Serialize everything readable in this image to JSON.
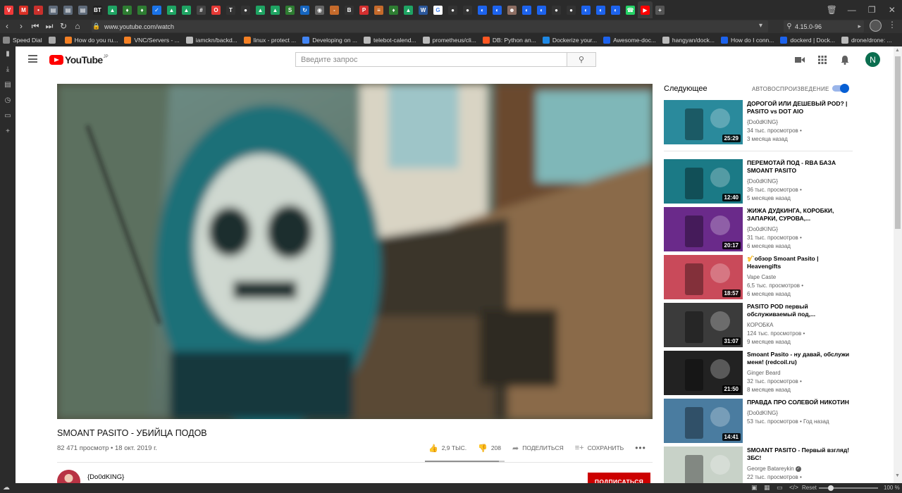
{
  "browser": {
    "url": "www.youtube.com/watch",
    "search_value": "4.15.0-96",
    "tabs": [
      {
        "name": "vivaldi",
        "color": "#ef3939",
        "glyph": "V"
      },
      {
        "name": "mail",
        "color": "#d93025",
        "glyph": "M"
      },
      {
        "name": "chat",
        "color": "#c9302c",
        "glyph": "•"
      },
      {
        "name": "doc",
        "color": "#5f6b7a",
        "glyph": "▤"
      },
      {
        "name": "doc",
        "color": "#5f6b7a",
        "glyph": "▤"
      },
      {
        "name": "doc",
        "color": "#5f6b7a",
        "glyph": "▤"
      },
      {
        "name": "bt",
        "color": "#222",
        "glyph": "BT"
      },
      {
        "name": "drive",
        "color": "#1fa463",
        "glyph": "▲"
      },
      {
        "name": "leaf",
        "color": "#2e7d32",
        "glyph": "♦"
      },
      {
        "name": "leaf",
        "color": "#2e7d32",
        "glyph": "♦"
      },
      {
        "name": "check",
        "color": "#1a73e8",
        "glyph": "✓"
      },
      {
        "name": "drive",
        "color": "#1fa463",
        "glyph": "▲"
      },
      {
        "name": "drive",
        "color": "#1fa463",
        "glyph": "▲"
      },
      {
        "name": "grid",
        "color": "#444",
        "glyph": "#"
      },
      {
        "name": "opera",
        "color": "#e53935",
        "glyph": "O"
      },
      {
        "name": "t",
        "color": "#333",
        "glyph": "T"
      },
      {
        "name": "github",
        "color": "#333",
        "glyph": "●"
      },
      {
        "name": "drive",
        "color": "#1fa463",
        "glyph": "▲"
      },
      {
        "name": "drive",
        "color": "#1fa463",
        "glyph": "▲"
      },
      {
        "name": "s",
        "color": "#2e7d32",
        "glyph": "S"
      },
      {
        "name": "refresh",
        "color": "#1565c0",
        "glyph": "↻"
      },
      {
        "name": "globe",
        "color": "#666",
        "glyph": "◉"
      },
      {
        "name": "dash",
        "color": "#c56a2b",
        "glyph": "-"
      },
      {
        "name": "b",
        "color": "#333",
        "glyph": "B"
      },
      {
        "name": "p",
        "color": "#d32f2f",
        "glyph": "P"
      },
      {
        "name": "bars",
        "color": "#c56a2b",
        "glyph": "≡"
      },
      {
        "name": "leaf",
        "color": "#2e7d32",
        "glyph": "♦"
      },
      {
        "name": "drive",
        "color": "#1fa463",
        "glyph": "▲"
      },
      {
        "name": "word",
        "color": "#2b579a",
        "glyph": "W"
      },
      {
        "name": "google",
        "color": "#fff",
        "glyph": "G"
      },
      {
        "name": "github",
        "color": "#333",
        "glyph": "●"
      },
      {
        "name": "github",
        "color": "#333",
        "glyph": "●"
      },
      {
        "name": "docker",
        "color": "#1d63ed",
        "glyph": "◐"
      },
      {
        "name": "docker",
        "color": "#1d63ed",
        "glyph": "◐"
      },
      {
        "name": "person",
        "color": "#8d6e63",
        "glyph": "☻"
      },
      {
        "name": "docker",
        "color": "#1d63ed",
        "glyph": "◐"
      },
      {
        "name": "docker",
        "color": "#1d63ed",
        "glyph": "◐"
      },
      {
        "name": "github",
        "color": "#333",
        "glyph": "●"
      },
      {
        "name": "github",
        "color": "#333",
        "glyph": "●"
      },
      {
        "name": "docker",
        "color": "#1d63ed",
        "glyph": "◐"
      },
      {
        "name": "docker",
        "color": "#1d63ed",
        "glyph": "◐"
      },
      {
        "name": "docker",
        "color": "#1d63ed",
        "glyph": "◐"
      },
      {
        "name": "whatsapp",
        "color": "#25d366",
        "glyph": "☎"
      },
      {
        "name": "youtube",
        "color": "#ff0000",
        "glyph": "▶"
      },
      {
        "name": "new-tab",
        "color": "#555",
        "glyph": "+"
      }
    ],
    "bookmarks": [
      {
        "label": "Speed Dial",
        "color": "#888"
      },
      {
        "label": "",
        "color": "#aaa"
      },
      {
        "label": "How do you ru...",
        "color": "#f48024"
      },
      {
        "label": "VNC/Servers - ...",
        "color": "#f48024"
      },
      {
        "label": "iamckn/backd...",
        "color": "#bbb"
      },
      {
        "label": "linux - protect ...",
        "color": "#f48024"
      },
      {
        "label": "Developing on ...",
        "color": "#4285f4"
      },
      {
        "label": "telebot-calend...",
        "color": "#bbb"
      },
      {
        "label": "prometheus/cli...",
        "color": "#bbb"
      },
      {
        "label": "DB: Python an...",
        "color": "#ff5722"
      },
      {
        "label": "Dockerize your...",
        "color": "#1e88e5"
      },
      {
        "label": "Awesome-doc...",
        "color": "#1d63ed"
      },
      {
        "label": "hangyan/dock...",
        "color": "#bbb"
      },
      {
        "label": "How do I conn...",
        "color": "#1d63ed"
      },
      {
        "label": "dockerd | Dock...",
        "color": "#1d63ed"
      },
      {
        "label": "drone/drone: ...",
        "color": "#bbb"
      }
    ],
    "zoom_reset": "Reset",
    "zoom_level": "100 %"
  },
  "youtube": {
    "logo_text": "YouTube",
    "region": "JP",
    "search_placeholder": "Введите запрос",
    "avatar_letter": "N"
  },
  "video": {
    "title": "SMOANT PASITO - УБИЙЦА ПОДОВ",
    "meta": "82 471 просмотр • 18 окт. 2019 г.",
    "likes": "2,9 ТЫС.",
    "dislikes": "208",
    "share_label": "ПОДЕЛИТЬСЯ",
    "save_label": "СОХРАНИТЬ",
    "more_label": "•••",
    "like_ratio": 0.93,
    "channel": "{Do0dKING}",
    "subscribe_label": "ПОДПИСАТЬСЯ"
  },
  "sidebar": {
    "next_label": "Следующее",
    "autoplay_label": "АВТОВОСПРОИЗВЕДЕНИЕ",
    "autoplay_on": true,
    "items": [
      {
        "title": "ДОРОГОЙ ИЛИ ДЕШЕВЫЙ POD? | PASITO vs DOT AIO",
        "channel": "{Do0dKING}",
        "views": "34 тыс. просмотров •",
        "age": "3 месяца назад",
        "duration": "25:29",
        "thumb": "#2a8a9c",
        "verified": false
      },
      {
        "title": "ПЕРЕМОТАЙ ПОД - RBA БАЗА SMOANT PASITO",
        "channel": "{Do0dKING}",
        "views": "36 тыс. просмотров •",
        "age": "5 месяцев назад",
        "duration": "12:40",
        "thumb": "#1b7a86",
        "verified": false
      },
      {
        "title": "ЖИЖА ДУДКИНГА, КОРОБКИ, ЗАПАРКИ, СУРОВА,...",
        "channel": "{Do0dKING}",
        "views": "31 тыс. просмотров •",
        "age": "6 месяцев назад",
        "duration": "20:17",
        "thumb": "#6a2a8a",
        "verified": false
      },
      {
        "title": "🎷обзор Smoant Pasito | Heavengifts",
        "channel": "Vape Caste",
        "views": "6,5 тыс. просмотров •",
        "age": "6 месяцев назад",
        "duration": "18:57",
        "thumb": "#c94a5a",
        "verified": false
      },
      {
        "title": "PASITO POD первый обслуживаемый под,...",
        "channel": "КОРОБКА",
        "views": "124 тыс. просмотров •",
        "age": "9 месяцев назад",
        "duration": "31:07",
        "thumb": "#3b3b3b",
        "verified": false
      },
      {
        "title": "Smoant Pasito - ну давай, обслужи меня! (redcoil.ru)",
        "channel": "Ginger Beard",
        "views": "32 тыс. просмотров •",
        "age": "8 месяцев назад",
        "duration": "21:50",
        "thumb": "#222",
        "verified": false
      },
      {
        "title": "ПРАВДА ПРО СОЛЕВОЙ НИКОТИН",
        "channel": "{Do0dKING}",
        "views": "53 тыс. просмотров • Год назад",
        "age": "",
        "duration": "14:41",
        "thumb": "#4a7ca0",
        "verified": false
      },
      {
        "title": "SMOANT PASITO - Первый взгляд! ЗБС!",
        "channel": "George Batareykin",
        "views": "22 тыс. просмотров •",
        "age": "",
        "duration": "",
        "thumb": "#c8d2c8",
        "verified": true
      }
    ]
  }
}
